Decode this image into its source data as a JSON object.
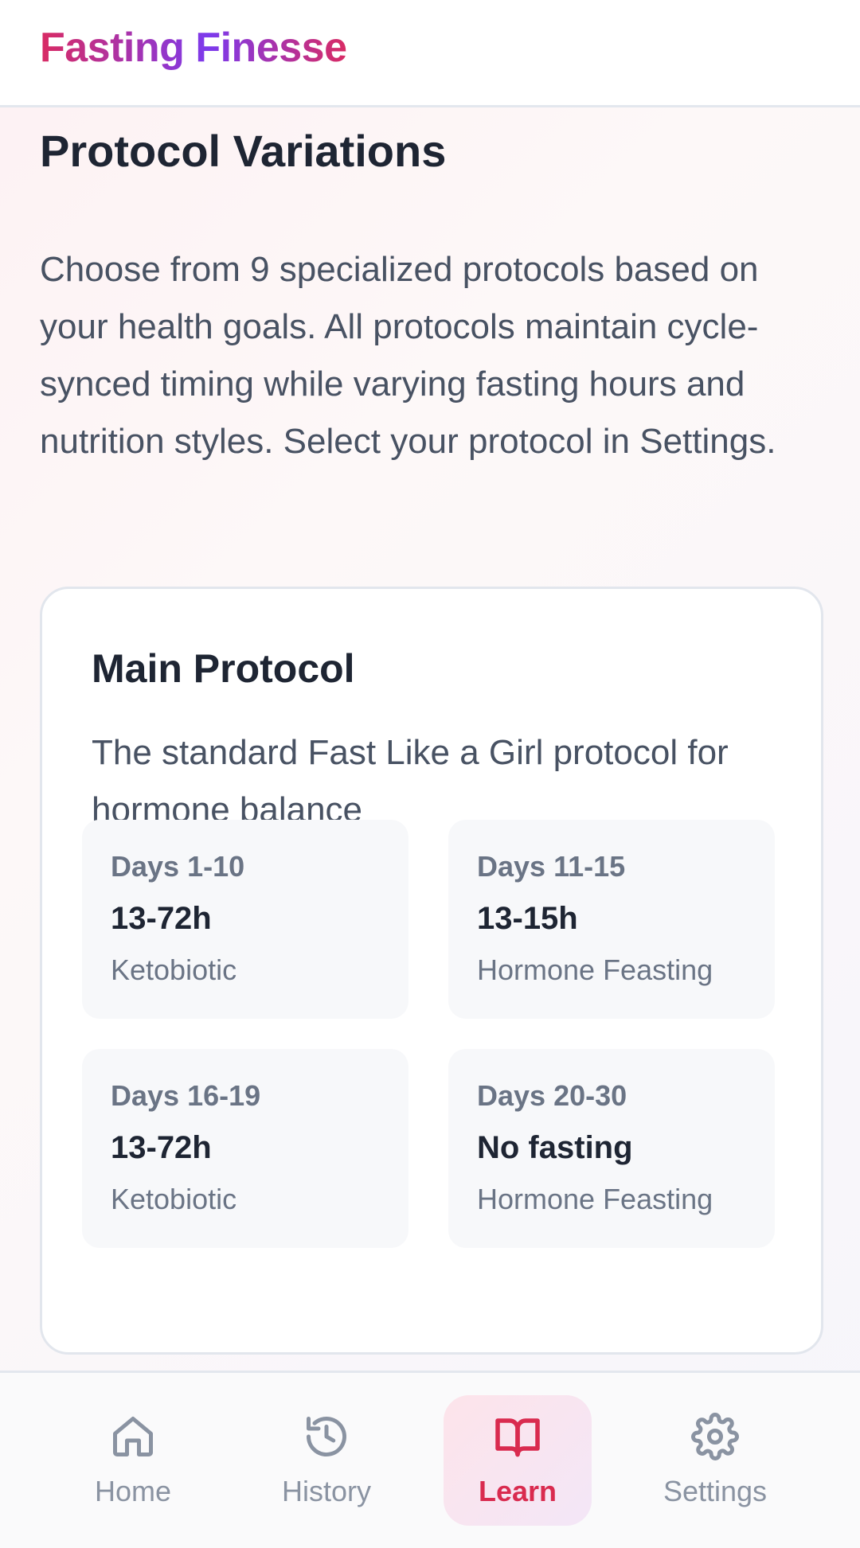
{
  "app": {
    "title": "Fasting Finesse"
  },
  "section": {
    "title": "Protocol Variations",
    "description": "Choose from 9 specialized protocols based on your health goals. All protocols maintain cycle-synced timing while varying fasting hours and nutrition styles. Select your protocol in Settings."
  },
  "card": {
    "title": "Main Protocol",
    "description": "The standard Fast Like a Girl protocol for hormone balance",
    "phases": [
      {
        "days": "Days 1-10",
        "hours": "13-72h",
        "type": "Ketobiotic"
      },
      {
        "days": "Days 11-15",
        "hours": "13-15h",
        "type": "Hormone Feasting"
      },
      {
        "days": "Days 16-19",
        "hours": "13-72h",
        "type": "Ketobiotic"
      },
      {
        "days": "Days 20-30",
        "hours": "No fasting",
        "type": "Hormone Feasting"
      }
    ]
  },
  "nav": {
    "items": [
      {
        "label": "Home",
        "icon": "home-icon",
        "active": false
      },
      {
        "label": "History",
        "icon": "history-icon",
        "active": false
      },
      {
        "label": "Learn",
        "icon": "book-open-icon",
        "active": true
      },
      {
        "label": "Settings",
        "icon": "gear-icon",
        "active": false
      }
    ]
  },
  "colors": {
    "accent": "#d92b4f",
    "brand_gradient_start": "#d92b63",
    "brand_gradient_mid": "#7c3aed",
    "text_dark": "#1e2533",
    "text_muted": "#6a7485",
    "nav_inactive": "#8a93a2"
  }
}
